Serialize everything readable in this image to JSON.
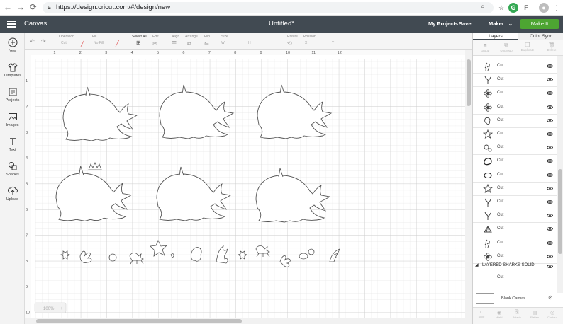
{
  "browser": {
    "url": "https://design.cricut.com/#/design/new",
    "ext_g": "G"
  },
  "header": {
    "menu_label": "Canvas",
    "doc_title": "Untitled*",
    "my_projects": "My Projects",
    "save": "Save",
    "machine": "Maker",
    "make_it": "Make It"
  },
  "toolbar": {
    "operation_label": "Operation",
    "operation_value": "Cut",
    "fill_label": "Fill",
    "fill_value": "No Fill",
    "select_all": "Select All",
    "edit": "Edit",
    "align": "Align",
    "arrange": "Arrange",
    "flip": "Flip",
    "size": "Size",
    "size_w": "W",
    "size_h": "H",
    "rotate": "Rotate",
    "position": "Position",
    "position_x": "X",
    "position_y": "Y"
  },
  "sidebar": [
    {
      "label": "New",
      "icon": "plus-circle-icon"
    },
    {
      "label": "Templates",
      "icon": "shirt-icon"
    },
    {
      "label": "Projects",
      "icon": "projects-icon"
    },
    {
      "label": "Images",
      "icon": "images-icon"
    },
    {
      "label": "Text",
      "icon": "text-icon"
    },
    {
      "label": "Shapes",
      "icon": "shapes-icon"
    },
    {
      "label": "Upload",
      "icon": "upload-icon"
    }
  ],
  "ruler": {
    "top": [
      "1",
      "2",
      "3",
      "4",
      "5",
      "6",
      "7",
      "8",
      "9",
      "10",
      "11",
      "12"
    ],
    "left": [
      "1",
      "2",
      "3",
      "4",
      "5",
      "6",
      "7",
      "8",
      "9",
      "10"
    ]
  },
  "zoom": "100%",
  "panel": {
    "tabs": [
      "Layers",
      "Color Sync"
    ],
    "tools": [
      "Group",
      "Ungroup",
      "Duplicate",
      "Delete"
    ],
    "layers": [
      {
        "label": "Cut",
        "thumb": "seaweed-icon"
      },
      {
        "label": "Cut",
        "thumb": "coral-icon"
      },
      {
        "label": "Cut",
        "thumb": "flower-icon"
      },
      {
        "label": "Cut",
        "thumb": "flower-icon"
      },
      {
        "label": "Cut",
        "thumb": "blob-icon"
      },
      {
        "label": "Cut",
        "thumb": "starfish-icon"
      },
      {
        "label": "Cut",
        "thumb": "bubble-icon"
      },
      {
        "label": "Cut",
        "thumb": "rock-icon"
      },
      {
        "label": "Cut",
        "thumb": "oval-icon"
      },
      {
        "label": "Cut",
        "thumb": "starfish-icon"
      },
      {
        "label": "Cut",
        "thumb": "coral-icon"
      },
      {
        "label": "Cut",
        "thumb": "coral-icon"
      },
      {
        "label": "Cut",
        "thumb": "shell-icon"
      },
      {
        "label": "Cut",
        "thumb": "seaweed-icon"
      },
      {
        "label": "Cut",
        "thumb": "flower-icon"
      }
    ],
    "group_name": "LAYERED SHARKS SOLID",
    "group_child": "Cut",
    "blank_canvas": "Blank Canvas",
    "bottom_tools": [
      "Slice",
      "Weld",
      "Attach",
      "Flatten",
      "Contour"
    ]
  }
}
